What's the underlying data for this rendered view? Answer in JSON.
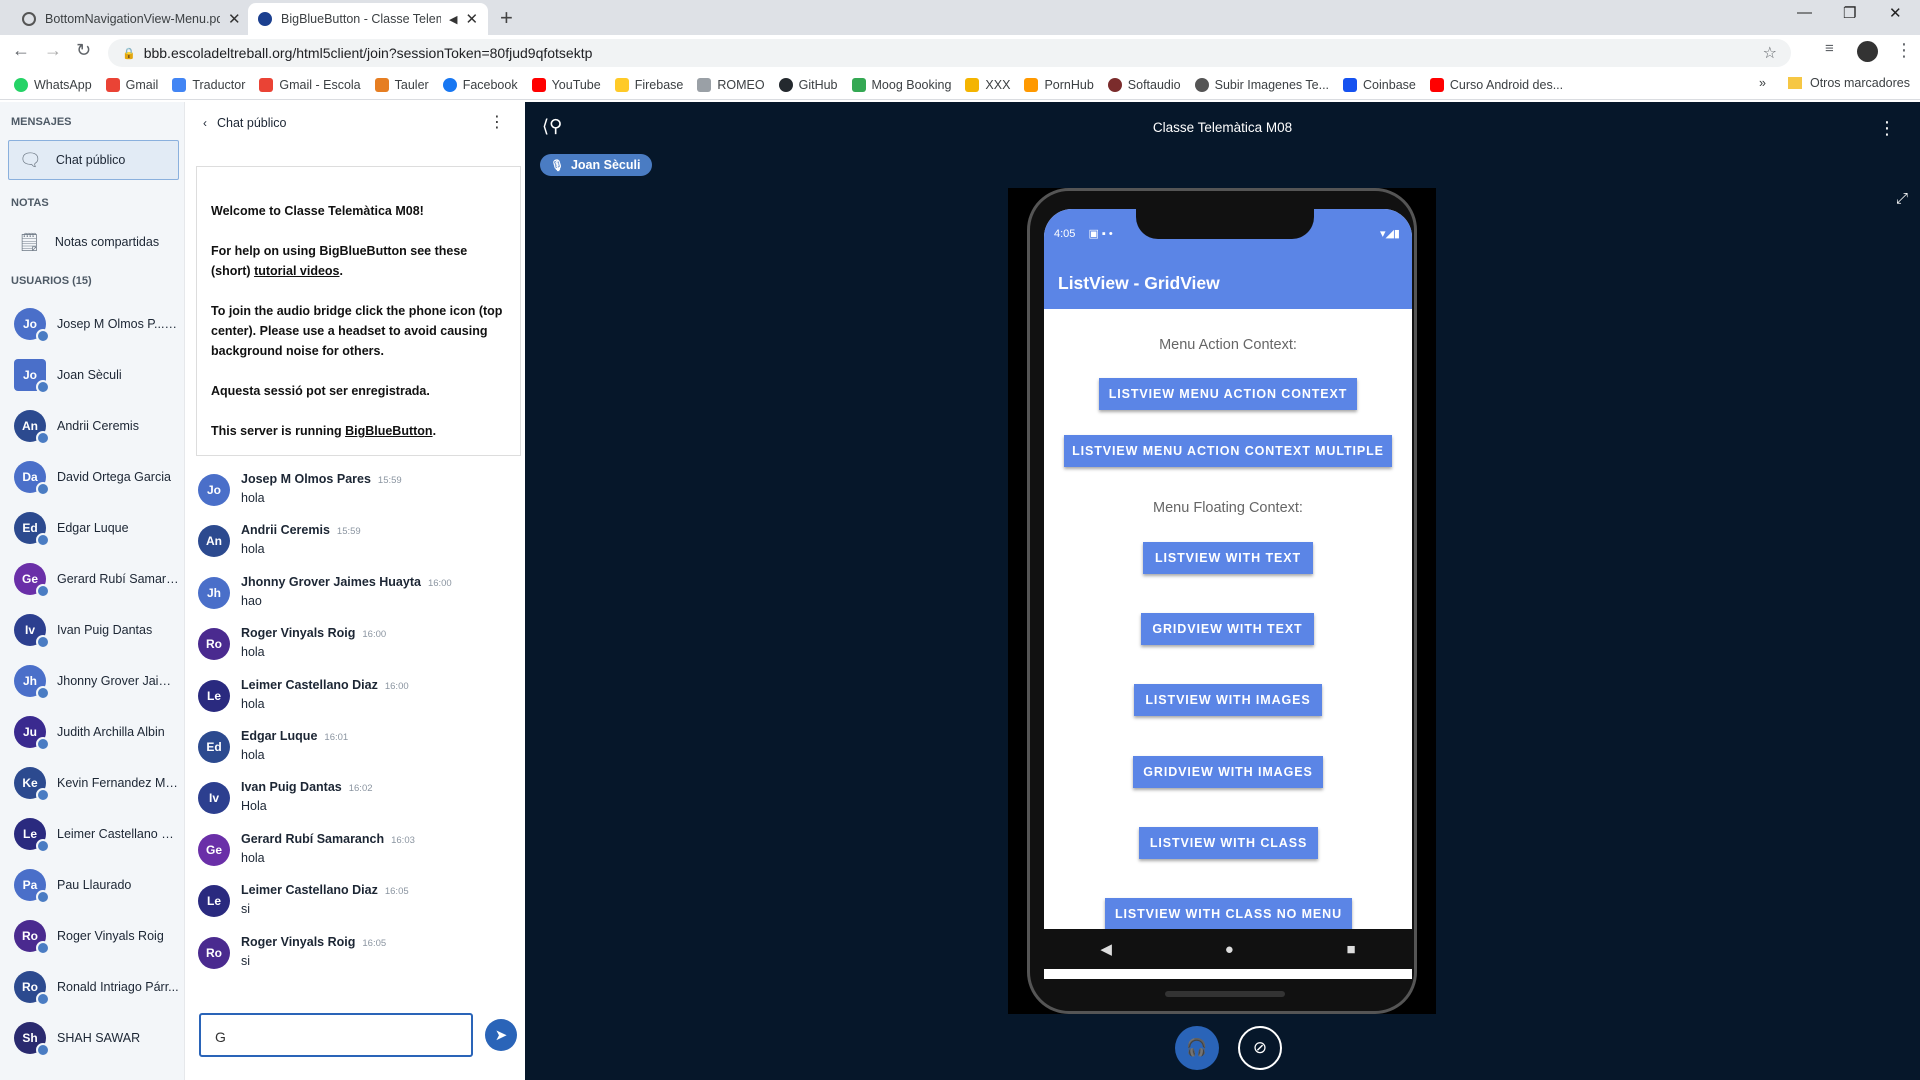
{
  "browser": {
    "tabs": [
      {
        "title": "BottomNavigationView-Menu.pdf"
      },
      {
        "title": "BigBlueButton - Classe Telem"
      }
    ],
    "url": "bbb.escoladeltreball.org/html5client/join?sessionToken=80fjud9qfotsektp",
    "bookmarks": [
      "WhatsApp",
      "Gmail",
      "Traductor",
      "Gmail - Escola",
      "Tauler",
      "Facebook",
      "YouTube",
      "Firebase",
      "ROMEO",
      "GitHub",
      "Moog Booking",
      "XXX",
      "PornHub",
      "Softaudio",
      "Subir Imagenes Te...",
      "Coinbase",
      "Curso Android des..."
    ],
    "other_bookmarks": "Otros marcadores"
  },
  "sidebar": {
    "messages_heading": "MENSAJES",
    "public_chat": "Chat público",
    "notes_heading": "NOTAS",
    "shared_notes": "Notas compartidas",
    "users_heading": "USUARIOS (15)",
    "users": [
      {
        "initials": "Jo",
        "name": "Josep M Olmos P...",
        "you": "(Tu)",
        "color": "#4a6fc9"
      },
      {
        "initials": "Jo",
        "name": "Joan Sèculi",
        "color": "#4a6fc9",
        "presenter": true
      },
      {
        "initials": "An",
        "name": "Andrii Ceremis",
        "color": "#2c4a8f"
      },
      {
        "initials": "Da",
        "name": "David Ortega Garcia",
        "color": "#4a6fc9"
      },
      {
        "initials": "Ed",
        "name": "Edgar Luque",
        "color": "#2c4a8f"
      },
      {
        "initials": "Ge",
        "name": "Gerard Rubí Samara...",
        "color": "#6a2fa8"
      },
      {
        "initials": "Iv",
        "name": "Ivan Puig Dantas",
        "color": "#2c3f8f"
      },
      {
        "initials": "Jh",
        "name": "Jhonny Grover Jaim...",
        "color": "#4a6fc9"
      },
      {
        "initials": "Ju",
        "name": "Judith Archilla Albin",
        "color": "#3a2a8f"
      },
      {
        "initials": "Ke",
        "name": "Kevin Fernandez Mu...",
        "color": "#2c4a8f"
      },
      {
        "initials": "Le",
        "name": "Leimer Castellano Di...",
        "color": "#2a2a7f"
      },
      {
        "initials": "Pa",
        "name": "Pau Llaurado",
        "color": "#4a6fc9"
      },
      {
        "initials": "Ro",
        "name": "Roger Vinyals Roig",
        "color": "#4a2a8f"
      },
      {
        "initials": "Ro",
        "name": "Ronald Intriago Párr...",
        "color": "#2c4a8f"
      },
      {
        "initials": "Sh",
        "name": "SHAH SAWAR",
        "color": "#2a2a6f"
      }
    ]
  },
  "chat": {
    "back_label": "Chat público",
    "welcome": {
      "title": "Welcome to Classe Telemàtica M08!",
      "help_pre": "For help on using BigBlueButton see these (short) ",
      "help_link": "tutorial videos",
      "help_post": ".",
      "audio": "To join the audio bridge click the phone icon (top center). Please use a headset to avoid causing background noise for others.",
      "recorded": "Aquesta sessió pot ser enregistrada.",
      "server_pre": "This server is running ",
      "server_link": "BigBlueButton",
      "server_post": "."
    },
    "messages": [
      {
        "initials": "Jo",
        "name": "Josep M Olmos Pares",
        "time": "15:59",
        "text": "hola",
        "color": "#4a6fc9"
      },
      {
        "initials": "An",
        "name": "Andrii Ceremis",
        "time": "15:59",
        "text": "hola",
        "color": "#2c4a8f"
      },
      {
        "initials": "Jh",
        "name": "Jhonny Grover Jaimes Huayta",
        "time": "16:00",
        "text": "hao",
        "color": "#4a6fc9"
      },
      {
        "initials": "Ro",
        "name": "Roger Vinyals Roig",
        "time": "16:00",
        "text": "hola",
        "color": "#4a2a8f"
      },
      {
        "initials": "Le",
        "name": "Leimer Castellano Diaz",
        "time": "16:00",
        "text": "hola",
        "color": "#2a2a7f"
      },
      {
        "initials": "Ed",
        "name": "Edgar Luque",
        "time": "16:01",
        "text": "hola",
        "color": "#2c4a8f"
      },
      {
        "initials": "Iv",
        "name": "Ivan Puig Dantas",
        "time": "16:02",
        "text": "Hola",
        "color": "#2c3f8f"
      },
      {
        "initials": "Ge",
        "name": "Gerard Rubí Samaranch",
        "time": "16:03",
        "text": "hola",
        "color": "#6a2fa8"
      },
      {
        "initials": "Le",
        "name": "Leimer Castellano Diaz",
        "time": "16:05",
        "text": "si",
        "color": "#2a2a7f"
      },
      {
        "initials": "Ro",
        "name": "Roger Vinyals Roig",
        "time": "16:05",
        "text": "si",
        "color": "#4a2a8f"
      }
    ],
    "input_value": "G"
  },
  "stage": {
    "title": "Classe Telemàtica M08",
    "presenter": "Joan Sèculi"
  },
  "phone": {
    "time": "4:05",
    "appbar_title": "ListView - GridView",
    "header1": "Menu Action Context:",
    "header2": "Menu Floating Context:",
    "buttons": [
      "LISTVIEW MENU ACTION CONTEXT",
      "LISTVIEW MENU ACTION CONTEXT MULTIPLE",
      "LISTVIEW WITH TEXT",
      "GRIDVIEW WITH TEXT",
      "LISTVIEW WITH IMAGES",
      "GRIDVIEW WITH IMAGES",
      "LISTVIEW WITH CLASS",
      "LISTVIEW WITH CLASS NO MENU"
    ]
  }
}
